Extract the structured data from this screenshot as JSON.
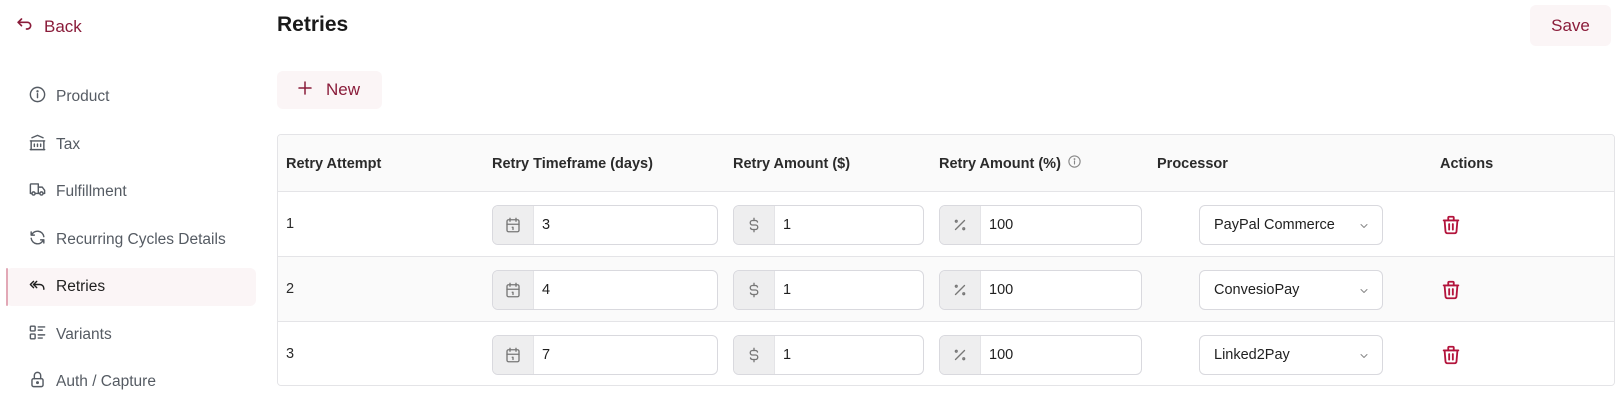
{
  "back_label": "Back",
  "sidebar": {
    "items": [
      {
        "label": "Product",
        "icon": "info-circle-icon",
        "active": false
      },
      {
        "label": "Tax",
        "icon": "bank-icon",
        "active": false
      },
      {
        "label": "Fulfillment",
        "icon": "truck-icon",
        "active": false
      },
      {
        "label": "Recurring Cycles Details",
        "icon": "refresh-icon",
        "active": false
      },
      {
        "label": "Retries",
        "icon": "reply-all-icon",
        "active": true
      },
      {
        "label": "Variants",
        "icon": "list-details-icon",
        "active": false
      },
      {
        "label": "Auth / Capture",
        "icon": "lock-icon",
        "active": false
      }
    ]
  },
  "page": {
    "title": "Retries",
    "save_label": "Save",
    "new_label": "New"
  },
  "table": {
    "headers": {
      "attempt": "Retry Attempt",
      "timeframe": "Retry Timeframe (days)",
      "amount_usd": "Retry Amount ($)",
      "amount_pct": "Retry Amount (%)",
      "processor": "Processor",
      "actions": "Actions"
    },
    "rows": [
      {
        "attempt": "1",
        "timeframe": "3",
        "amount_usd": "1",
        "amount_pct": "100",
        "processor": "PayPal Commerce"
      },
      {
        "attempt": "2",
        "timeframe": "4",
        "amount_usd": "1",
        "amount_pct": "100",
        "processor": "ConvesioPay"
      },
      {
        "attempt": "3",
        "timeframe": "7",
        "amount_usd": "1",
        "amount_pct": "100",
        "processor": "Linked2Pay"
      }
    ]
  },
  "colors": {
    "accent": "#8a1c3a",
    "delete": "#b3143c",
    "active_bg": "#fbf5f6"
  }
}
